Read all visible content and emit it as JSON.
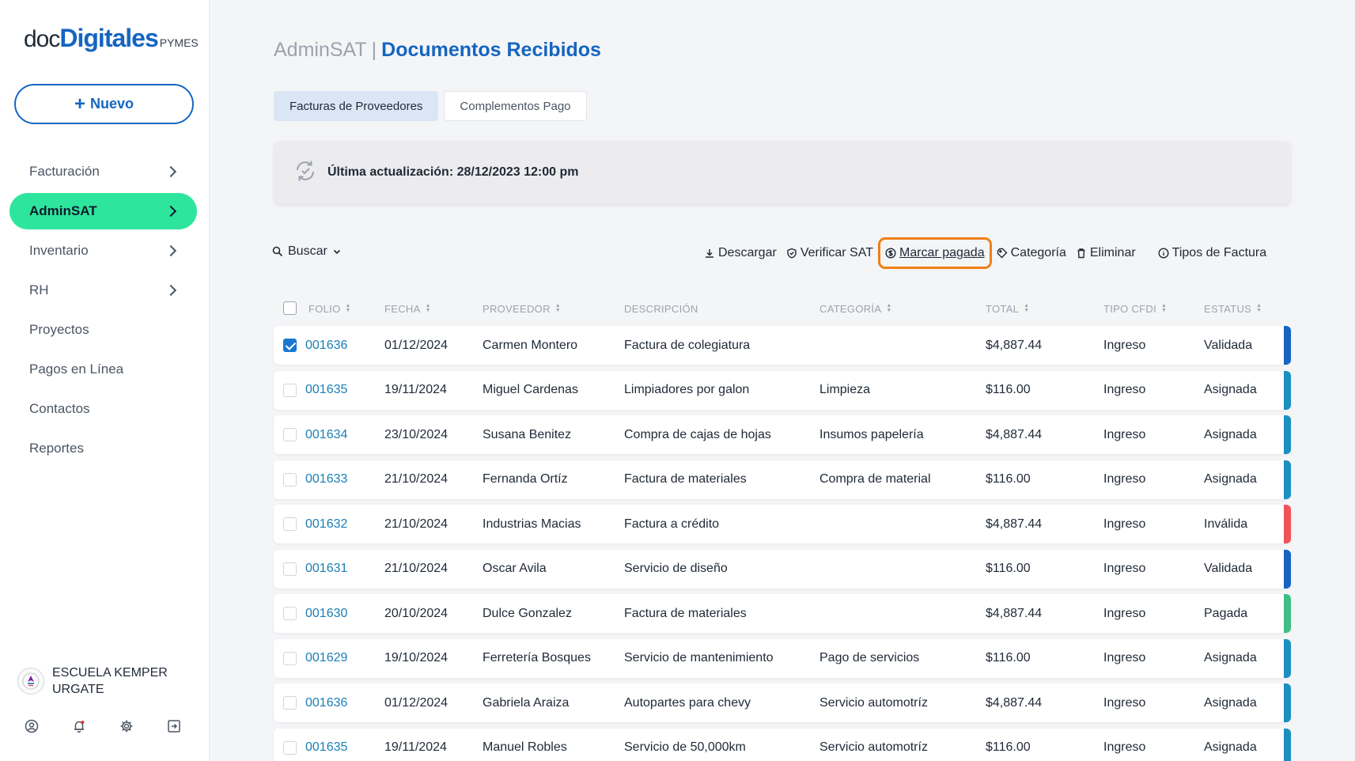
{
  "logo": {
    "part1": "doc",
    "part2": "Digitales",
    "part3": "PYMES"
  },
  "new_button": {
    "plus": "+",
    "label": "Nuevo"
  },
  "nav": [
    {
      "label": "Facturación",
      "chevron": true,
      "active": false
    },
    {
      "label": "AdminSAT",
      "chevron": true,
      "active": true
    },
    {
      "label": "Inventario",
      "chevron": true,
      "active": false
    },
    {
      "label": "RH",
      "chevron": true,
      "active": false
    },
    {
      "label": "Proyectos",
      "chevron": false,
      "active": false
    },
    {
      "label": "Pagos en Línea",
      "chevron": false,
      "active": false
    },
    {
      "label": "Contactos",
      "chevron": false,
      "active": false
    },
    {
      "label": "Reportes",
      "chevron": false,
      "active": false
    }
  ],
  "company": {
    "name": "ESCUELA KEMPER URGATE",
    "logo_icon": "school-crest-icon"
  },
  "bottom_icons": [
    "user-circle-icon",
    "bell-icon",
    "gear-icon",
    "logout-icon"
  ],
  "header": {
    "crumb": "AdminSAT",
    "separator": "|",
    "title": "Documentos Recibidos"
  },
  "tabs": [
    {
      "label": "Facturas de Proveedores",
      "active": true
    },
    {
      "label": "Complementos Pago",
      "active": false
    }
  ],
  "update_bar": {
    "icon": "sync-icon",
    "text": "Última actualización: 28/12/2023 12:00 pm"
  },
  "search": {
    "label": "Buscar",
    "icon": "search-icon",
    "caret_icon": "chevron-down-icon"
  },
  "actions": [
    {
      "label": "Descargar",
      "icon": "download-icon"
    },
    {
      "label": "Verificar SAT",
      "icon": "shield-check-icon"
    },
    {
      "label": "Marcar pagada",
      "icon": "dollar-circle-icon",
      "highlighted": true
    },
    {
      "label": "Categoría",
      "icon": "tag-icon"
    },
    {
      "label": "Eliminar",
      "icon": "trash-icon"
    },
    {
      "label": "Tipos de Factura",
      "icon": "info-icon"
    }
  ],
  "table": {
    "columns": {
      "folio": "FOLIO",
      "fecha": "FECHA",
      "proveedor": "PROVEEDOR",
      "descripcion": "DESCRIPCIÓN",
      "categoria": "CATEGORÍA",
      "total": "TOTAL",
      "tipo": "TIPO CFDI",
      "estatus": "ESTATUS"
    },
    "rows": [
      {
        "checked": true,
        "folio": "001636",
        "fecha": "01/12/2024",
        "proveedor": "Carmen Montero",
        "descripcion": "Factura de colegiatura",
        "categoria": "",
        "total": "$4,887.44",
        "tipo": "Ingreso",
        "estatus": "Validada",
        "status_color": "#1565c0"
      },
      {
        "checked": false,
        "folio": "001635",
        "fecha": "19/11/2024",
        "proveedor": "Miguel Cardenas",
        "descripcion": "Limpiadores por galon",
        "categoria": "Limpieza",
        "total": "$116.00",
        "tipo": "Ingreso",
        "estatus": "Asignada",
        "status_color": "#1a8fc0"
      },
      {
        "checked": false,
        "folio": "001634",
        "fecha": "23/10/2024",
        "proveedor": "Susana Benitez",
        "descripcion": "Compra de cajas de hojas",
        "categoria": "Insumos papelería",
        "total": "$4,887.44",
        "tipo": "Ingreso",
        "estatus": "Asignada",
        "status_color": "#1a8fc0"
      },
      {
        "checked": false,
        "folio": "001633",
        "fecha": "21/10/2024",
        "proveedor": "Fernanda Ortíz",
        "descripcion": "Factura de materiales",
        "categoria": "Compra de material",
        "total": "$116.00",
        "tipo": "Ingreso",
        "estatus": "Asignada",
        "status_color": "#1a8fc0"
      },
      {
        "checked": false,
        "folio": "001632",
        "fecha": "21/10/2024",
        "proveedor": "Industrias Macias",
        "descripcion": "Factura a crédito",
        "categoria": "",
        "total": "$4,887.44",
        "tipo": "Ingreso",
        "estatus": "Inválida",
        "status_color": "#f0525a"
      },
      {
        "checked": false,
        "folio": "001631",
        "fecha": "21/10/2024",
        "proveedor": "Oscar Avila",
        "descripcion": "Servicio de diseño",
        "categoria": "",
        "total": "$116.00",
        "tipo": "Ingreso",
        "estatus": "Validada",
        "status_color": "#1565c0"
      },
      {
        "checked": false,
        "folio": "001630",
        "fecha": "20/10/2024",
        "proveedor": "Dulce Gonzalez",
        "descripcion": "Factura de materiales",
        "categoria": "",
        "total": "$4,887.44",
        "tipo": "Ingreso",
        "estatus": "Pagada",
        "status_color": "#3fbf86"
      },
      {
        "checked": false,
        "folio": "001629",
        "fecha": "19/10/2024",
        "proveedor": "Ferretería Bosques",
        "descripcion": "Servicio de mantenimiento",
        "categoria": "Pago de servicios",
        "total": "$116.00",
        "tipo": "Ingreso",
        "estatus": "Asignada",
        "status_color": "#1a8fc0"
      },
      {
        "checked": false,
        "folio": "001636",
        "fecha": "01/12/2024",
        "proveedor": "Gabriela Araiza",
        "descripcion": "Autopartes para chevy",
        "categoria": "Servicio automotríz",
        "total": "$4,887.44",
        "tipo": "Ingreso",
        "estatus": "Asignada",
        "status_color": "#1a8fc0"
      },
      {
        "checked": false,
        "folio": "001635",
        "fecha": "19/11/2024",
        "proveedor": "Manuel Robles",
        "descripcion": "Servicio de 50,000km",
        "categoria": "Servicio automotríz",
        "total": "$116.00",
        "tipo": "Ingreso",
        "estatus": "Asignada",
        "status_color": "#1a8fc0"
      }
    ]
  }
}
